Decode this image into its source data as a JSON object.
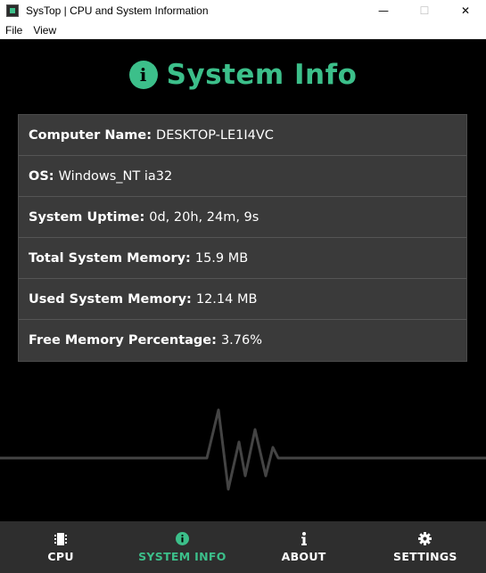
{
  "window": {
    "title": "SysTop | CPU and System Information",
    "minimize_glyph": "—",
    "maximize_glyph": "☐",
    "close_glyph": "✕"
  },
  "menu": {
    "items": [
      "File",
      "View"
    ]
  },
  "heading": {
    "icon": "info-circle-icon",
    "icon_glyph": "i",
    "title": "System Info",
    "accent_color": "#3cbf8a"
  },
  "info": {
    "rows": [
      {
        "label": "Computer Name:",
        "value": "DESKTOP-LE1I4VC"
      },
      {
        "label": "OS:",
        "value": "Windows_NT ia32"
      },
      {
        "label": "System Uptime:",
        "value": "0d, 20h, 24m, 9s"
      },
      {
        "label": "Total System Memory:",
        "value": "15.9 MB"
      },
      {
        "label": "Used System Memory:",
        "value": "12.14 MB"
      },
      {
        "label": "Free Memory Percentage:",
        "value": "3.76%"
      }
    ]
  },
  "nav": {
    "items": [
      {
        "label": "CPU",
        "icon": "microchip-icon",
        "active": false
      },
      {
        "label": "SYSTEM INFO",
        "icon": "info-circle-icon",
        "active": true
      },
      {
        "label": "ABOUT",
        "icon": "info-icon",
        "active": false
      },
      {
        "label": "SETTINGS",
        "icon": "gear-icon",
        "active": false
      }
    ]
  }
}
